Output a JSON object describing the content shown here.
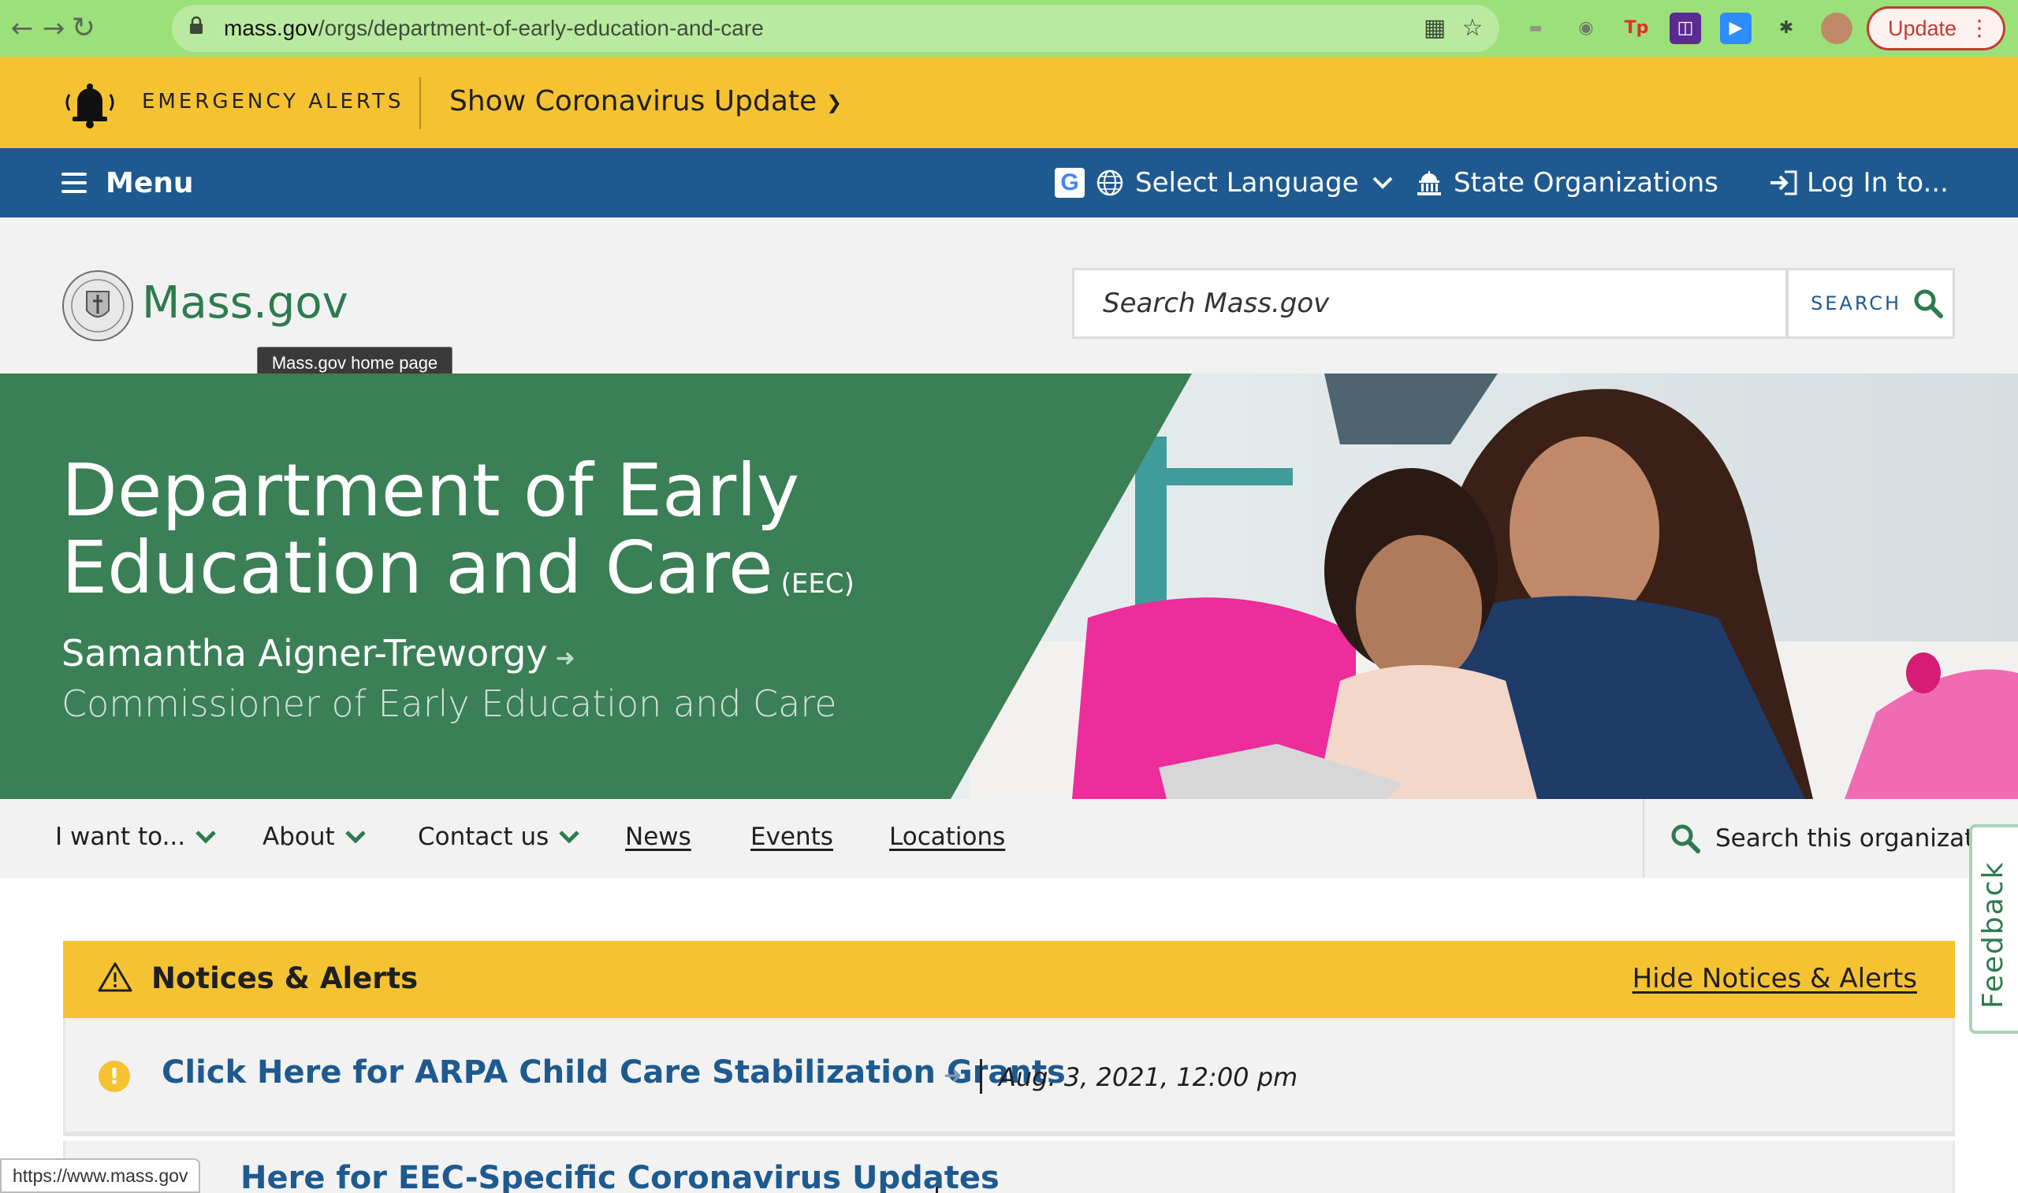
{
  "browser": {
    "url_host": "mass.gov",
    "url_path": "/orgs/department-of-early-education-and-care",
    "update_label": "Update"
  },
  "emergency": {
    "label": "EMERGENCY ALERTS",
    "toggle": "Show Coronavirus Update"
  },
  "utility_nav": {
    "menu": "Menu",
    "language": "Select Language",
    "state_orgs": "State Organizations",
    "login": "Log In to..."
  },
  "header": {
    "site_name": "Mass.gov",
    "tooltip": "Mass.gov home page",
    "search_placeholder": "Search Mass.gov",
    "search_button": "SEARCH"
  },
  "hero": {
    "title_line1": "Department of Early",
    "title_line2": "Education and Care",
    "abbr": "(EEC)",
    "person": "Samantha Aigner-Treworgy",
    "role": "Commissioner of Early Education and Care"
  },
  "org_nav": {
    "items": [
      {
        "label": "I want to...",
        "dropdown": true
      },
      {
        "label": "About",
        "dropdown": true
      },
      {
        "label": "Contact us",
        "dropdown": true
      },
      {
        "label": "News",
        "dropdown": false
      },
      {
        "label": "Events",
        "dropdown": false
      },
      {
        "label": "Locations",
        "dropdown": false
      }
    ],
    "search_label": "Search this organization"
  },
  "feedback": "Feedback",
  "notices": {
    "title": "Notices & Alerts",
    "hide": "Hide Notices & Alerts",
    "items": [
      {
        "title": "Click Here for ARPA Child Care Stabilization Grants",
        "date": "Aug. 3, 2021, 12:00 pm"
      },
      {
        "title": "Here for EEC-Specific Coronavirus Updates"
      }
    ]
  },
  "status_bar": "https://www.mass.gov",
  "colors": {
    "brand_green": "#2d7b4e",
    "hero_green": "#3a7f55",
    "nav_blue": "#1e5a8f",
    "alert_yellow": "#f5c232"
  }
}
